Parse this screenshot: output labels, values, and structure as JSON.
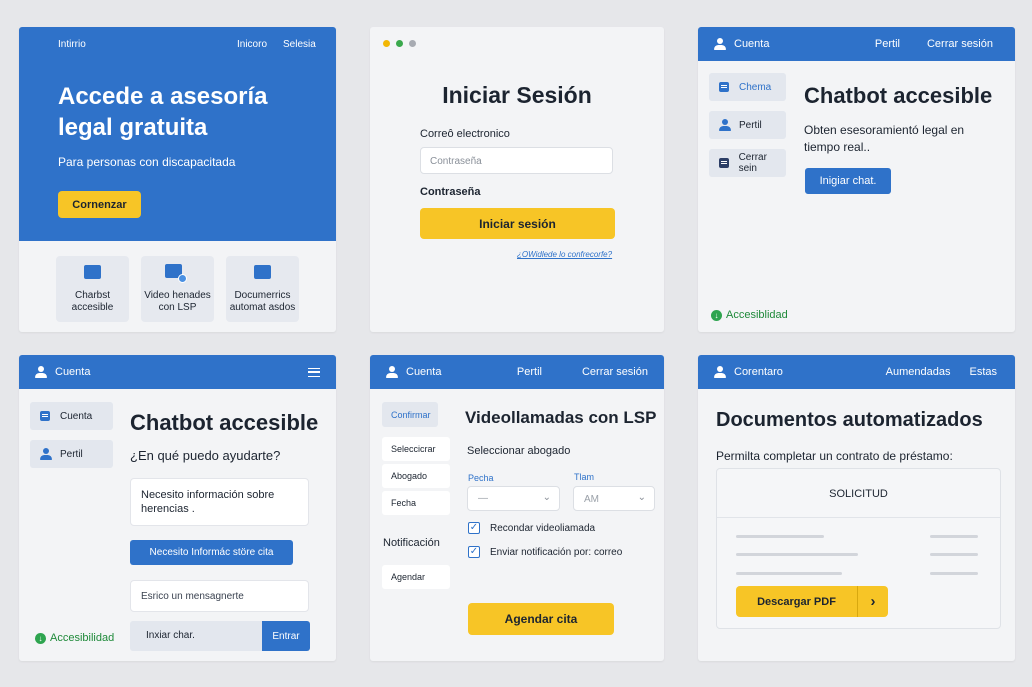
{
  "p1": {
    "brand": "Intirrio",
    "nav": [
      "Inicoro",
      "Selesia"
    ],
    "hero_title_1": "Accede a asesoría",
    "hero_title_2": "legal gratuita",
    "hero_sub": "Para personas con discapacitada",
    "cta": "Cornenzar",
    "cards": [
      {
        "l1": "Charbst",
        "l2": "accesible"
      },
      {
        "l1": "Video henades",
        "l2": "con LSP"
      },
      {
        "l1": "Documerrics",
        "l2": "automat asdos"
      }
    ]
  },
  "p2": {
    "title": "Iniciar Sesión",
    "email_label": "Correô electronico",
    "email_placeholder": "Contraseña",
    "pass_label": "Contraseña",
    "submit": "Iniciar sesión",
    "forgot": "¿OWidlede lo confrecorfe?"
  },
  "p3": {
    "account": "Cuenta",
    "nav": [
      "Pertil",
      "Cerrar sesión"
    ],
    "side": [
      "Chema",
      "Pertil",
      "Cerrar sein"
    ],
    "title": "Chatbot accesible",
    "desc_1": "Obten esesoramientó legal en",
    "desc_2": "tiempo real..",
    "btn": "Inigiar chat.",
    "access": "Accesiblidad"
  },
  "p4": {
    "account": "Cuenta",
    "side": [
      "Cuenta",
      "Pertil"
    ],
    "title": "Chatbot accesible",
    "question": "¿En qué puedo ayudarte?",
    "msg_1": "Necesito información sobre",
    "msg_2": "herencias .",
    "reply": "Necesito Informác störe cita",
    "input_placeholder": "Esrico un mensagnerte",
    "start": "Inxiar char.",
    "send": "Entrar",
    "access": "Accesibilidad"
  },
  "p5": {
    "account": "Cuenta",
    "nav": [
      "Pertil",
      "Cerrar sesión"
    ],
    "side": [
      "Confirmar",
      "Seleccicrar",
      "Abogado",
      "Fecha"
    ],
    "side_head": "Notificación",
    "side_last": "Agendar",
    "title": "Videollamadas con LSP",
    "select_label": "Seleccionar abogado",
    "date_label": "Pecha",
    "date_value": "—",
    "time_label": "Tlam",
    "time_value": "AM",
    "check_1": "Recondar videoliamada",
    "check_2": "Enviar notificación por: correo",
    "submit": "Agendar cita"
  },
  "p6": {
    "account": "Corentaro",
    "nav": [
      "Aumendadas",
      "Estas"
    ],
    "title": "Documentos automatizados",
    "desc": "Permilta completar un contrato de préstamo:",
    "doc_title": "SOLICITUD",
    "download": "Descargar PDF",
    "arrow": "›"
  },
  "colors": {
    "primary": "#2f72c9",
    "accent": "#f7c526",
    "success": "#2ea44f"
  }
}
